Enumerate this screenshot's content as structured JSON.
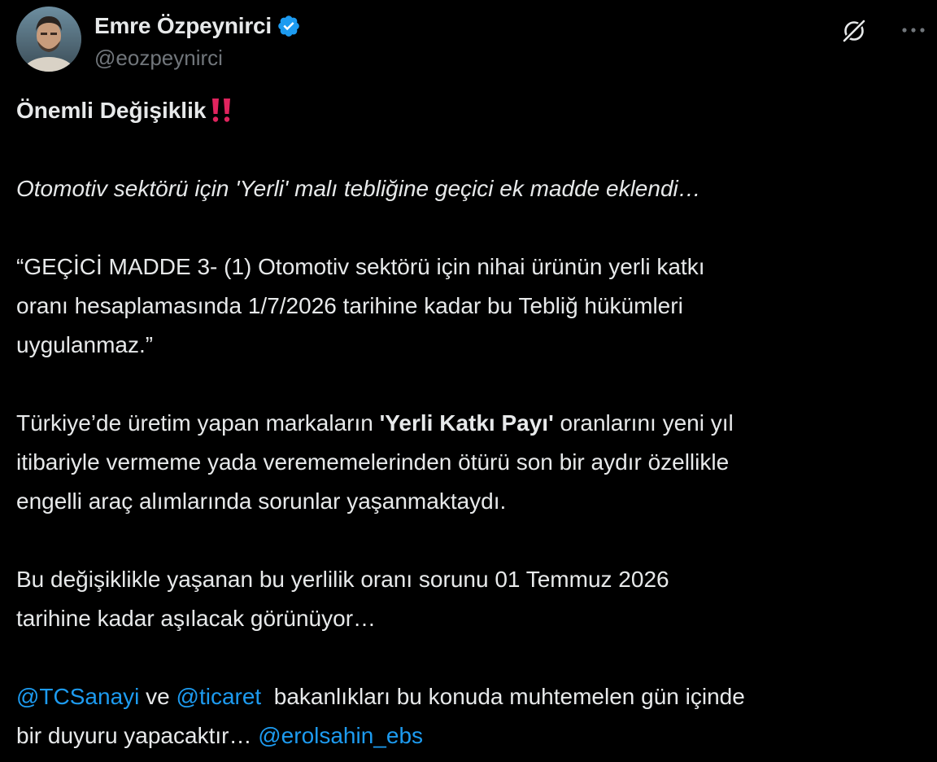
{
  "author": {
    "display_name": "Emre Özpeynirci",
    "handle": "@eozpeynirci",
    "verified": true,
    "verified_color": "#1d9bf0"
  },
  "icons": {
    "verified": "verified-badge-icon",
    "grok": "grok-icon",
    "more": "more-options-icon",
    "exclaim": "double-exclamation-emoji"
  },
  "colors": {
    "background": "#000000",
    "text": "#e7e9ea",
    "secondary": "#71767b",
    "link": "#1d9bf0",
    "exclaim": "#e0245e"
  },
  "tweet": {
    "title": "Önemli Değişiklik",
    "subtitle": "Otomotiv sektörü için 'Yerli' malı tebliğine geçici ek madde eklendi…",
    "quote": [
      "“GEÇİCİ MADDE 3- (1) Otomotiv sektörü için nihai ürünün yerli katkı",
      "oranı hesaplamasında 1/7/2026 tarihine kadar bu Tebliğ hükümleri",
      "uygulanmaz.”"
    ],
    "para2": {
      "line1_pre": "Türkiye’de üretim yapan markaların ",
      "line1_bold": "'Yerli Katkı Payı'",
      "line1_post": " oranlarını yeni yıl",
      "line2": "itibariyle vermeme yada verememelerinden ötürü son bir aydır özellikle",
      "line3": "engelli araç alımlarında sorunlar yaşanmaktaydı."
    },
    "para3": [
      "Bu değişiklikle  yaşanan bu yerlilik oranı sorunu 01 Temmuz 2026",
      "tarihine kadar aşılacak  görünüyor…"
    ],
    "para4": {
      "mention1": "@TCSanayi",
      "text1": " ve ",
      "mention2": "@ticaret",
      "text2": "  bakanlıkları bu konuda muhtemelen gün içinde",
      "line2_text": "bir duyuru yapacaktır… ",
      "mention3": "@erolsahin_ebs"
    }
  }
}
